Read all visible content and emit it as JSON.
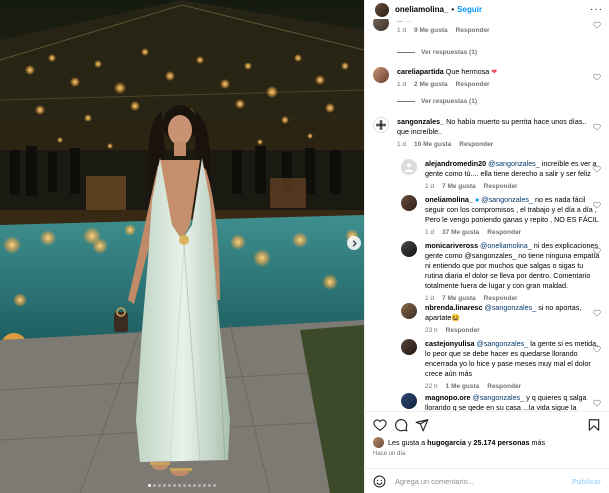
{
  "post": {
    "username": "oneliamolina_",
    "follow_label": "Seguir",
    "separator": "•",
    "more_label": "···"
  },
  "photo": {
    "slide_count": 14,
    "active_slide": 1
  },
  "comments": [
    {
      "id": "c0",
      "username": "...",
      "text": "...",
      "time": "1 d",
      "likes": "9 Me gusta",
      "reply_label": "Responder",
      "view_replies": "Ver respuestas (1)"
    },
    {
      "id": "c1",
      "username": "careliapartida",
      "text": "Que hermosa",
      "time": "1 d",
      "likes": "2 Me gusta",
      "reply_label": "Responder",
      "view_replies": "Ver respuestas (1)"
    },
    {
      "id": "c2",
      "username": "sangonzales_",
      "text": "No había muerto su perrita hace unos días.. que increíble..",
      "time": "1 d",
      "likes": "10 Me gusta",
      "reply_label": "Responder"
    }
  ],
  "replies": [
    {
      "username": "alejandromedin20",
      "mention": "@sangonzales_",
      "text": "increíble es ver a gente como tú.... ella tiene derecho a salir y ser feliz",
      "time": "1 d",
      "likes": "7 Me gusta",
      "reply_label": "Responder"
    },
    {
      "username": "oneliamolina_",
      "mention": "@sangonzales_",
      "text": "no es nada fácil seguir con los compromisos , el trabajo y el día a día , Pero le vengo poniendo ganas y repito , NO ES FÁCIL",
      "time": "1 d",
      "likes": "37 Me gusta",
      "reply_label": "Responder"
    },
    {
      "username": "monicariveross",
      "mention": "@oneliamolina_",
      "text": "ni des explicaciones gente como @sangonzales_ no tiene ninguna empatía ni entiendo que por muchos que salgas o sigas tu rutina diaria el dolor se lleva por dentro. Comentario totalmente fuera de lugar y con gran maldad.",
      "time": "1 d",
      "likes": "7 Me gusta",
      "reply_label": "Responder"
    },
    {
      "username": "nbrenda.linaresc",
      "mention": "@sangonzales_",
      "text": "si no aportas, apartate😆",
      "time": "23 h",
      "likes": "",
      "reply_label": "Responder"
    },
    {
      "username": "castejonyulisa",
      "mention": "@sangonzales_",
      "text": "la gente si es metida, lo peor que se debe hacer es quedarse llorando encerrada yo lo hice y pase meses muy mal el dolor crece aún más",
      "time": "22 h",
      "likes": "1 Me gusta",
      "reply_label": "Responder"
    },
    {
      "username": "magnopo.ore",
      "mention": "@sangonzales_",
      "text": "y q quieres q salga llorando q se qede en su casa ...la vida sigue la tristeza se lleva adentro el tiempo ...",
      "time": "",
      "likes": "",
      "reply_label": ""
    }
  ],
  "actions": {
    "likes_prefix": "Les gusta a",
    "likes_user": "hugogarcia",
    "likes_joiner": "y",
    "likes_count": "25.174 personas",
    "likes_suffix": "más",
    "time_ago": "Hace un día"
  },
  "add_comment": {
    "placeholder": "Agrega un comentario...",
    "post_label": "Publicar"
  },
  "colors": {
    "link_blue": "#0095f6",
    "mention_blue": "#00376b",
    "meta_gray": "#737373",
    "heart_red": "#ed4956"
  }
}
